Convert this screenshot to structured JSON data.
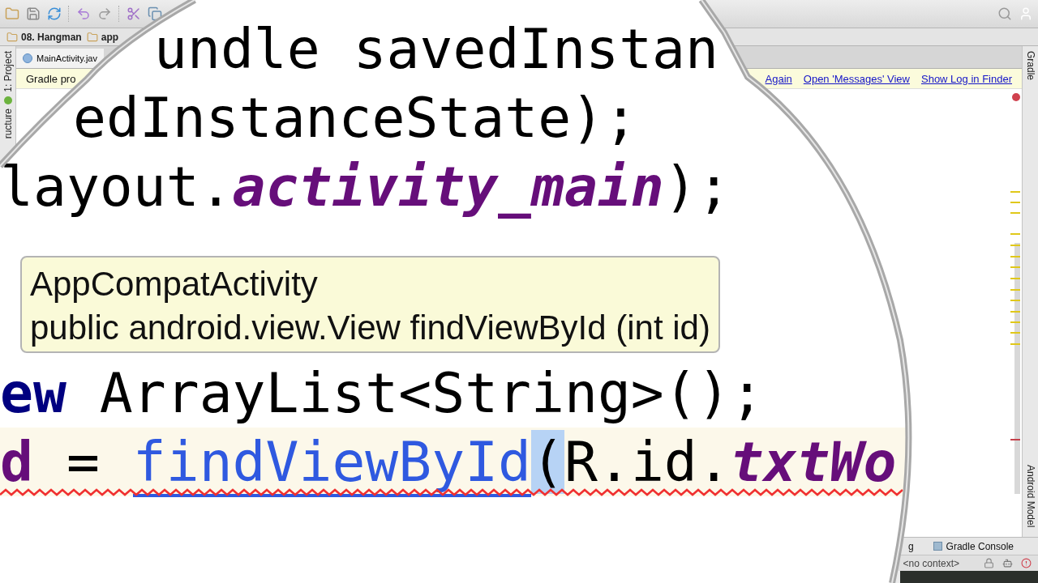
{
  "breadcrumbs": [
    "08. Hangman",
    "app"
  ],
  "left_strip": {
    "tabs": [
      "1: Project",
      "ructure"
    ]
  },
  "editor_tab": {
    "label": "MainActivity.jav"
  },
  "notification": {
    "text": "Gradle pro",
    "links": [
      "Again",
      "Open 'Messages' View",
      "Show Log in Finder"
    ]
  },
  "right_strip": {
    "tabs": [
      "Gradle",
      "Android Model"
    ]
  },
  "bottom_tools": [
    "g",
    "Gradle Console"
  ],
  "status_bar": {
    "context": "<no context>"
  },
  "magnified_code": {
    "lines": [
      {
        "current": false,
        "error": false,
        "segments": [
          {
            "text": "undle savedInstan",
            "kind": "plain"
          }
        ]
      },
      {
        "current": false,
        "error": false,
        "segments": [
          {
            "text": "edInstanceState);",
            "kind": "plain"
          }
        ]
      },
      {
        "current": false,
        "error": false,
        "segments": [
          {
            "text": "layout.",
            "kind": "plain"
          },
          {
            "text": "activity_main",
            "kind": "field"
          },
          {
            "text": ");",
            "kind": "plain"
          }
        ]
      },
      {
        "current": false,
        "error": false,
        "segments": [
          {
            "text": "ew",
            "kind": "keyword"
          },
          {
            "text": " ArrayList<String>();",
            "kind": "plain"
          }
        ]
      },
      {
        "current": true,
        "error": true,
        "segments": [
          {
            "text": "d",
            "kind": "variable"
          },
          {
            "text": " = ",
            "kind": "plain"
          },
          {
            "text": "findViewById",
            "kind": "link"
          },
          {
            "text": "(",
            "kind": "brace"
          },
          {
            "text": "R.id.",
            "kind": "plain"
          },
          {
            "text": "txtWo",
            "kind": "field"
          }
        ]
      }
    ]
  },
  "tooltip": {
    "title": "AppCompatActivity",
    "signature": "public android.view.View findViewById (int id)"
  }
}
